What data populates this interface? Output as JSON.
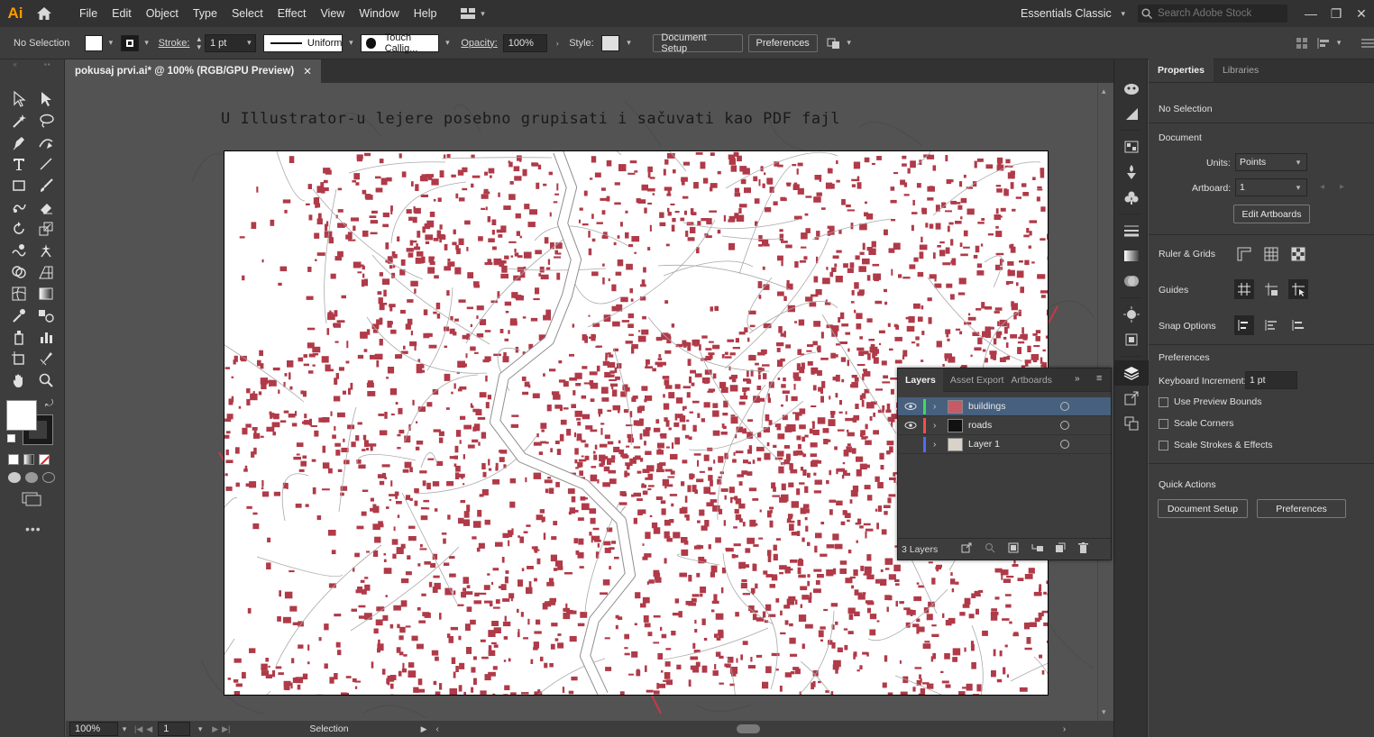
{
  "app": {
    "logo": "Ai"
  },
  "menu": [
    "File",
    "Edit",
    "Object",
    "Type",
    "Select",
    "Effect",
    "View",
    "Window",
    "Help"
  ],
  "workspace": {
    "label": "Essentials Classic"
  },
  "search": {
    "placeholder": "Search Adobe Stock"
  },
  "control_bar": {
    "selection": "No Selection",
    "stroke_label": "Stroke:",
    "stroke_weight": "1 pt",
    "stroke_profile": "Uniform",
    "brush": "Touch Callig...",
    "opacity_label": "Opacity:",
    "opacity_value": "100%",
    "style_label": "Style:",
    "document_setup": "Document Setup",
    "preferences": "Preferences"
  },
  "document_tab": {
    "title": "pokusaj prvi.ai* @ 100% (RGB/GPU Preview)"
  },
  "canvas": {
    "heading": "U Illustrator-u lejere posebno grupisati i sačuvati kao PDF fajl"
  },
  "status": {
    "zoom": "100%",
    "artboard": "1",
    "tool": "Selection"
  },
  "properties": {
    "tabs": [
      "Properties",
      "Libraries"
    ],
    "selection": "No Selection",
    "document_title": "Document",
    "units_label": "Units:",
    "units_value": "Points",
    "artboard_label": "Artboard:",
    "artboard_value": "1",
    "edit_artboards": "Edit Artboards",
    "ruler_grids": "Ruler & Grids",
    "guides": "Guides",
    "snap_options": "Snap Options",
    "preferences_title": "Preferences",
    "keyboard_increment_label": "Keyboard Increment:",
    "keyboard_increment_value": "1 pt",
    "use_preview_bounds": "Use Preview Bounds",
    "scale_corners": "Scale Corners",
    "scale_strokes": "Scale Strokes & Effects",
    "quick_actions": "Quick Actions",
    "qa_document_setup": "Document Setup",
    "qa_preferences": "Preferences"
  },
  "layers_panel": {
    "tabs": [
      "Layers",
      "Asset Export",
      "Artboards"
    ],
    "layers": [
      {
        "name": "buildings",
        "color": "#3fdc53",
        "visible": true,
        "selected": true
      },
      {
        "name": "roads",
        "color": "#ff4b4b",
        "visible": true,
        "selected": false
      },
      {
        "name": "Layer 1",
        "color": "#4b6bff",
        "visible": false,
        "selected": false
      }
    ],
    "count": "3 Layers"
  },
  "colors": {
    "map_red": "#b03a48",
    "selection_blue": "#46607e",
    "ai_orange": "#ff9a00"
  }
}
